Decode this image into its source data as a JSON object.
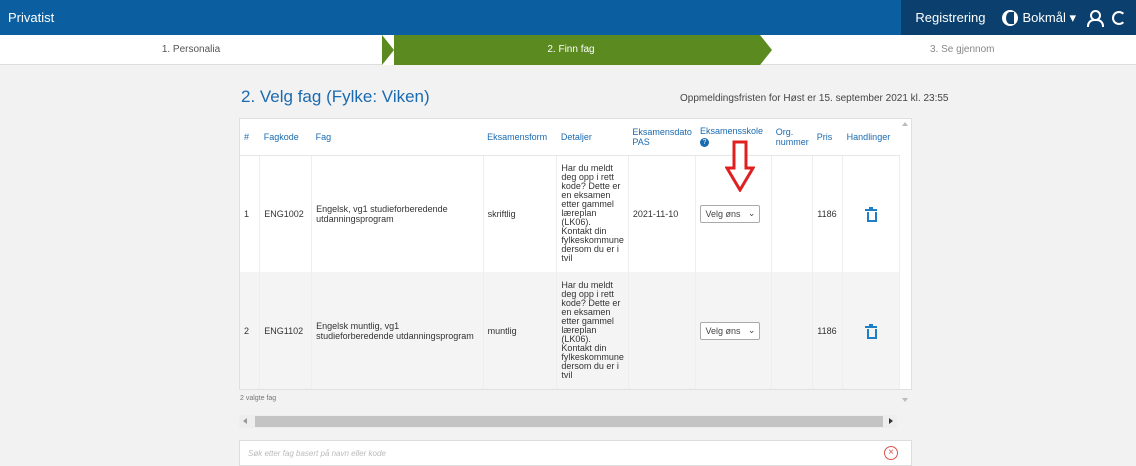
{
  "header": {
    "brand": "Privatist",
    "registration": "Registrering",
    "language": "Bokmål ▾"
  },
  "steps": [
    "1. Personalia",
    "2. Finn fag",
    "3. Se gjennom"
  ],
  "page": {
    "title": "2. Velg fag (Fylke: Viken)",
    "deadline": "Oppmeldingsfristen for Høst er 15. september 2021 kl. 23:55"
  },
  "table": {
    "headers": {
      "num": "#",
      "code": "Fagkode",
      "subject": "Fag",
      "form": "Eksamensform",
      "details": "Detaljer",
      "date": "Eksamensdato PAS",
      "school": "Eksamensskole",
      "org": "Org. nummer",
      "price": "Pris",
      "actions": "Handlinger"
    },
    "rows": [
      {
        "num": "1",
        "code": "ENG1002",
        "subject": "Engelsk, vg1 studieforberedende utdanningsprogram",
        "form": "skriftlig",
        "details": "Har du meldt deg opp i rett kode? Dette er en eksamen etter gammel læreplan (LK06). Kontakt din fylkeskommune dersom du er i tvil",
        "date": "2021-11-10",
        "school": "Velg øns",
        "price": "1186"
      },
      {
        "num": "2",
        "code": "ENG1102",
        "subject": "Engelsk muntlig, vg1 studieforberedende utdanningsprogram",
        "form": "muntlig",
        "details": "Har du meldt deg opp i rett kode? Dette er en eksamen etter gammel læreplan (LK06). Kontakt din fylkeskommune dersom du er i tvil",
        "date": "",
        "school": "Velg øns",
        "price": "1186"
      }
    ],
    "count": "2 valgte fag"
  },
  "search": {
    "placeholder": "Søk etter fag basert på navn eller kode"
  },
  "colors": {
    "topbar": "#0b5fa0",
    "step_active": "#5a8a20",
    "link": "#1a6ab0",
    "arrow": "#e02020"
  }
}
